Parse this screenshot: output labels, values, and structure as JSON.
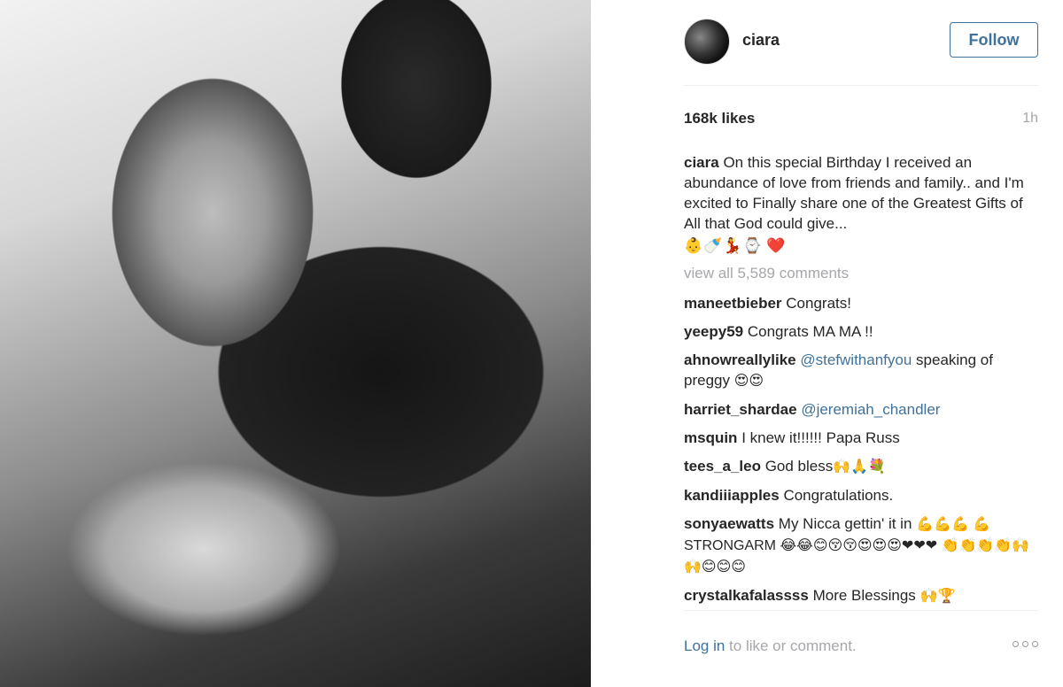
{
  "post": {
    "username": "ciara",
    "follow_label": "Follow",
    "likes": "168k likes",
    "time": "1h",
    "caption_user": "ciara",
    "caption_text": "On this special Birthday I received an abundance of love from friends and family.. and I'm excited to Finally share one of the Greatest Gifts of All that God could give...",
    "caption_emoji": "👶🍼💃⌚",
    "caption_heart": "❤️",
    "view_all": "view all 5,589 comments"
  },
  "comments": [
    {
      "user": "maneetbieber",
      "text": "Congrats!"
    },
    {
      "user": "yeepy59",
      "text": "Congrats MA MA !!"
    },
    {
      "user": "ahnowreallylike",
      "mention": "@stefwithanfyou",
      "text": "speaking of preggy",
      "emoji": "😍😍"
    },
    {
      "user": "harriet_shardae",
      "mention": "@jeremiah_chandler"
    },
    {
      "user": "msquin",
      "text": "I knew it!!!!!! Papa Russ"
    },
    {
      "user": "tees_a_leo",
      "text": "God bless",
      "emoji": "🙌🙏💐"
    },
    {
      "user": "kandiiiapples",
      "text": "Congratulations."
    },
    {
      "user": "sonyaewatts",
      "text": "My Nicca gettin' it in",
      "emoji": "💪💪💪 💪STRONGARM 😂😂😊😚😚😍😍😍❤❤❤ 👏👏👏👏🙌🙌😊😊😊"
    },
    {
      "user": "crystalkafalassss",
      "text": "More Blessings",
      "emoji": "🙌🏆"
    }
  ],
  "footer": {
    "login": "Log in",
    "rest": " to like or comment."
  },
  "icons": {
    "more": "more-options-icon"
  },
  "colors": {
    "link": "#3f729b",
    "muted": "#a5a7aa",
    "text": "#262626"
  }
}
